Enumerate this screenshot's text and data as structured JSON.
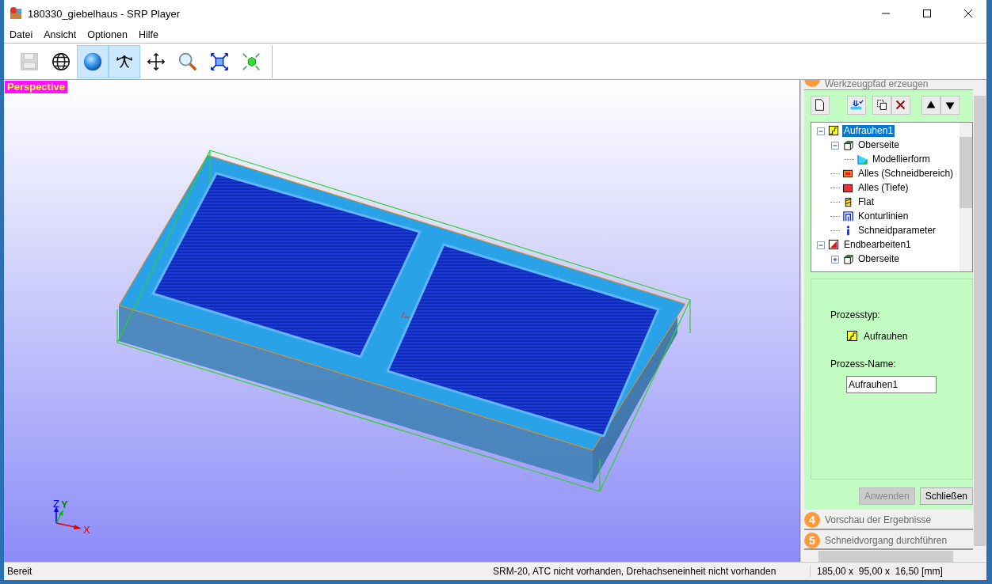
{
  "window": {
    "title": "180330_giebelhaus - SRP Player"
  },
  "menu": [
    "Datei",
    "Ansicht",
    "Optionen",
    "Hilfe"
  ],
  "toolbar": [
    {
      "kind": "save",
      "selected": false,
      "disabled": true
    },
    {
      "kind": "globe",
      "selected": false,
      "disabled": false
    },
    {
      "kind": "sphere",
      "selected": true,
      "disabled": false
    },
    {
      "kind": "rotate",
      "selected": true,
      "disabled": false
    },
    {
      "kind": "pan",
      "selected": false,
      "disabled": false
    },
    {
      "kind": "zoom",
      "selected": false,
      "disabled": false
    },
    {
      "kind": "fit",
      "selected": false,
      "disabled": false
    },
    {
      "kind": "shrink",
      "selected": false,
      "disabled": false
    }
  ],
  "viewport": {
    "label": "Perspective",
    "axes": {
      "x": "X",
      "y": "Y",
      "z": "Z"
    }
  },
  "panel": {
    "section": {
      "title": "Werkzeugpfad erzeugen"
    },
    "tools": [
      {
        "kind": "new",
        "disabled": false
      },
      {
        "kind": "process",
        "disabled": false
      },
      {
        "kind": "copy",
        "disabled": false
      },
      {
        "kind": "delete",
        "disabled": false
      },
      {
        "kind": "up",
        "disabled": false
      },
      {
        "kind": "down",
        "disabled": false
      }
    ],
    "tree": [
      {
        "label": "Aufrauhen1",
        "kind": "rough",
        "selected": true,
        "expanded": true,
        "children": [
          {
            "label": "Oberseite",
            "kind": "surface",
            "selected": false,
            "expanded": true,
            "children": [
              {
                "label": "Modellierform",
                "kind": "model",
                "selected": false
              }
            ]
          },
          {
            "label": "Alles (Schneidbereich)",
            "kind": "area",
            "selected": false
          },
          {
            "label": "Alles (Tiefe)",
            "kind": "depth",
            "selected": false
          },
          {
            "label": "Flat",
            "kind": "flat",
            "selected": false
          },
          {
            "label": "Konturlinien",
            "kind": "contour",
            "selected": false
          },
          {
            "label": "Schneidparameter",
            "kind": "params",
            "selected": false
          }
        ]
      },
      {
        "label": "Endbearbeiten1",
        "kind": "finish",
        "selected": false,
        "expanded": true,
        "children": [
          {
            "label": "Oberseite",
            "kind": "surface",
            "selected": false,
            "expanded": false
          }
        ]
      }
    ],
    "form": {
      "type_label": "Prozesstyp:",
      "type_value": "Aufrauhen",
      "name_label": "Prozess-Name:",
      "name_value": "Aufrauhen1"
    },
    "buttons": [
      {
        "label": "Anwenden",
        "disabled": true
      },
      {
        "label": "Schließen",
        "disabled": false
      }
    ],
    "steps": [
      {
        "number": "4",
        "title": "Vorschau der Ergebnisse"
      },
      {
        "number": "5",
        "title": "Schneidvorgang durchführen"
      }
    ]
  },
  "status_bar": {
    "left": "Bereit",
    "middle": "SRM-20, ATC nicht vorhanden, Drehachseneinheit nicht vorhanden",
    "right": "185,00 x  95,00 x  16,50 [mm]"
  }
}
